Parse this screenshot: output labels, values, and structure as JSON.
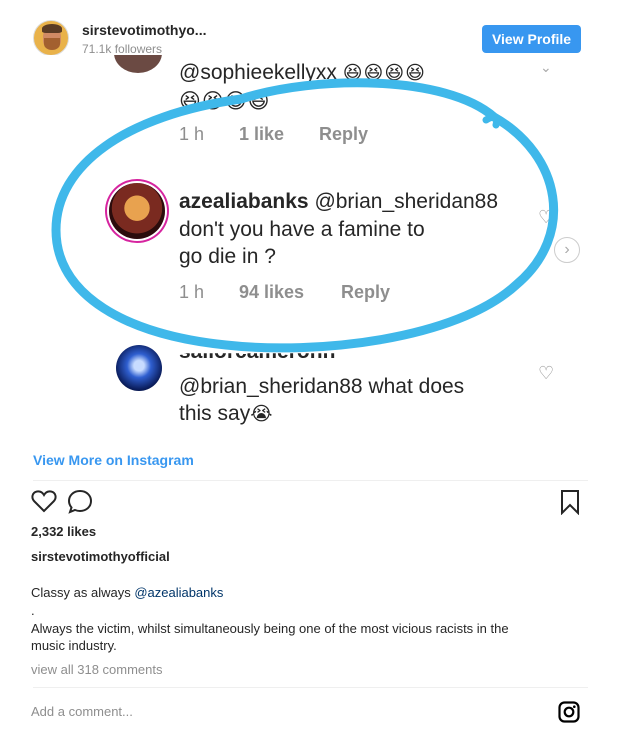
{
  "header": {
    "username": "sirstevotimothyo...",
    "followers": "71.1k followers",
    "view_profile_label": "View Profile"
  },
  "screenshot": {
    "top_comment": {
      "mention": "@sophieekellyxx",
      "emoji_line1": "😆😆😆😆",
      "emoji_line2": "😆😆😆😆",
      "time": "1 h",
      "likes": "1 like",
      "reply": "Reply"
    },
    "highlighted_comment": {
      "user": "azealiabanks",
      "mention": "@brian_sheridan88",
      "line1": "don't you have a famine to",
      "line2": "go die in ?",
      "time": "1 h",
      "likes": "94 likes",
      "reply": "Reply"
    },
    "bottom_comment": {
      "user_partial": "sailorcameronn",
      "mention": "@brian_sheridan88",
      "line1_rest": " what does",
      "line2": "this say",
      "emoji": "😭"
    },
    "circle_color": "#3fb8ea"
  },
  "view_more": "View More on Instagram",
  "likes": "2,332 likes",
  "owner": "sirstevotimothyofficial",
  "caption": {
    "prefix": "Classy as always ",
    "mention": "@azealiabanks",
    "dot": ".",
    "line3": "Always the victim, whilst simultaneously being one of the most vicious racists in the",
    "line4": "music industry."
  },
  "view_all": "view all 318 comments",
  "add_comment_placeholder": "Add a comment...",
  "icons": {
    "like": "heart-outline-icon",
    "comment": "comment-bubble-icon",
    "save": "bookmark-icon",
    "instagram": "instagram-logo-icon"
  },
  "colors": {
    "accent": "#3897f0",
    "muted": "#8e8e8e",
    "text": "#262626"
  }
}
